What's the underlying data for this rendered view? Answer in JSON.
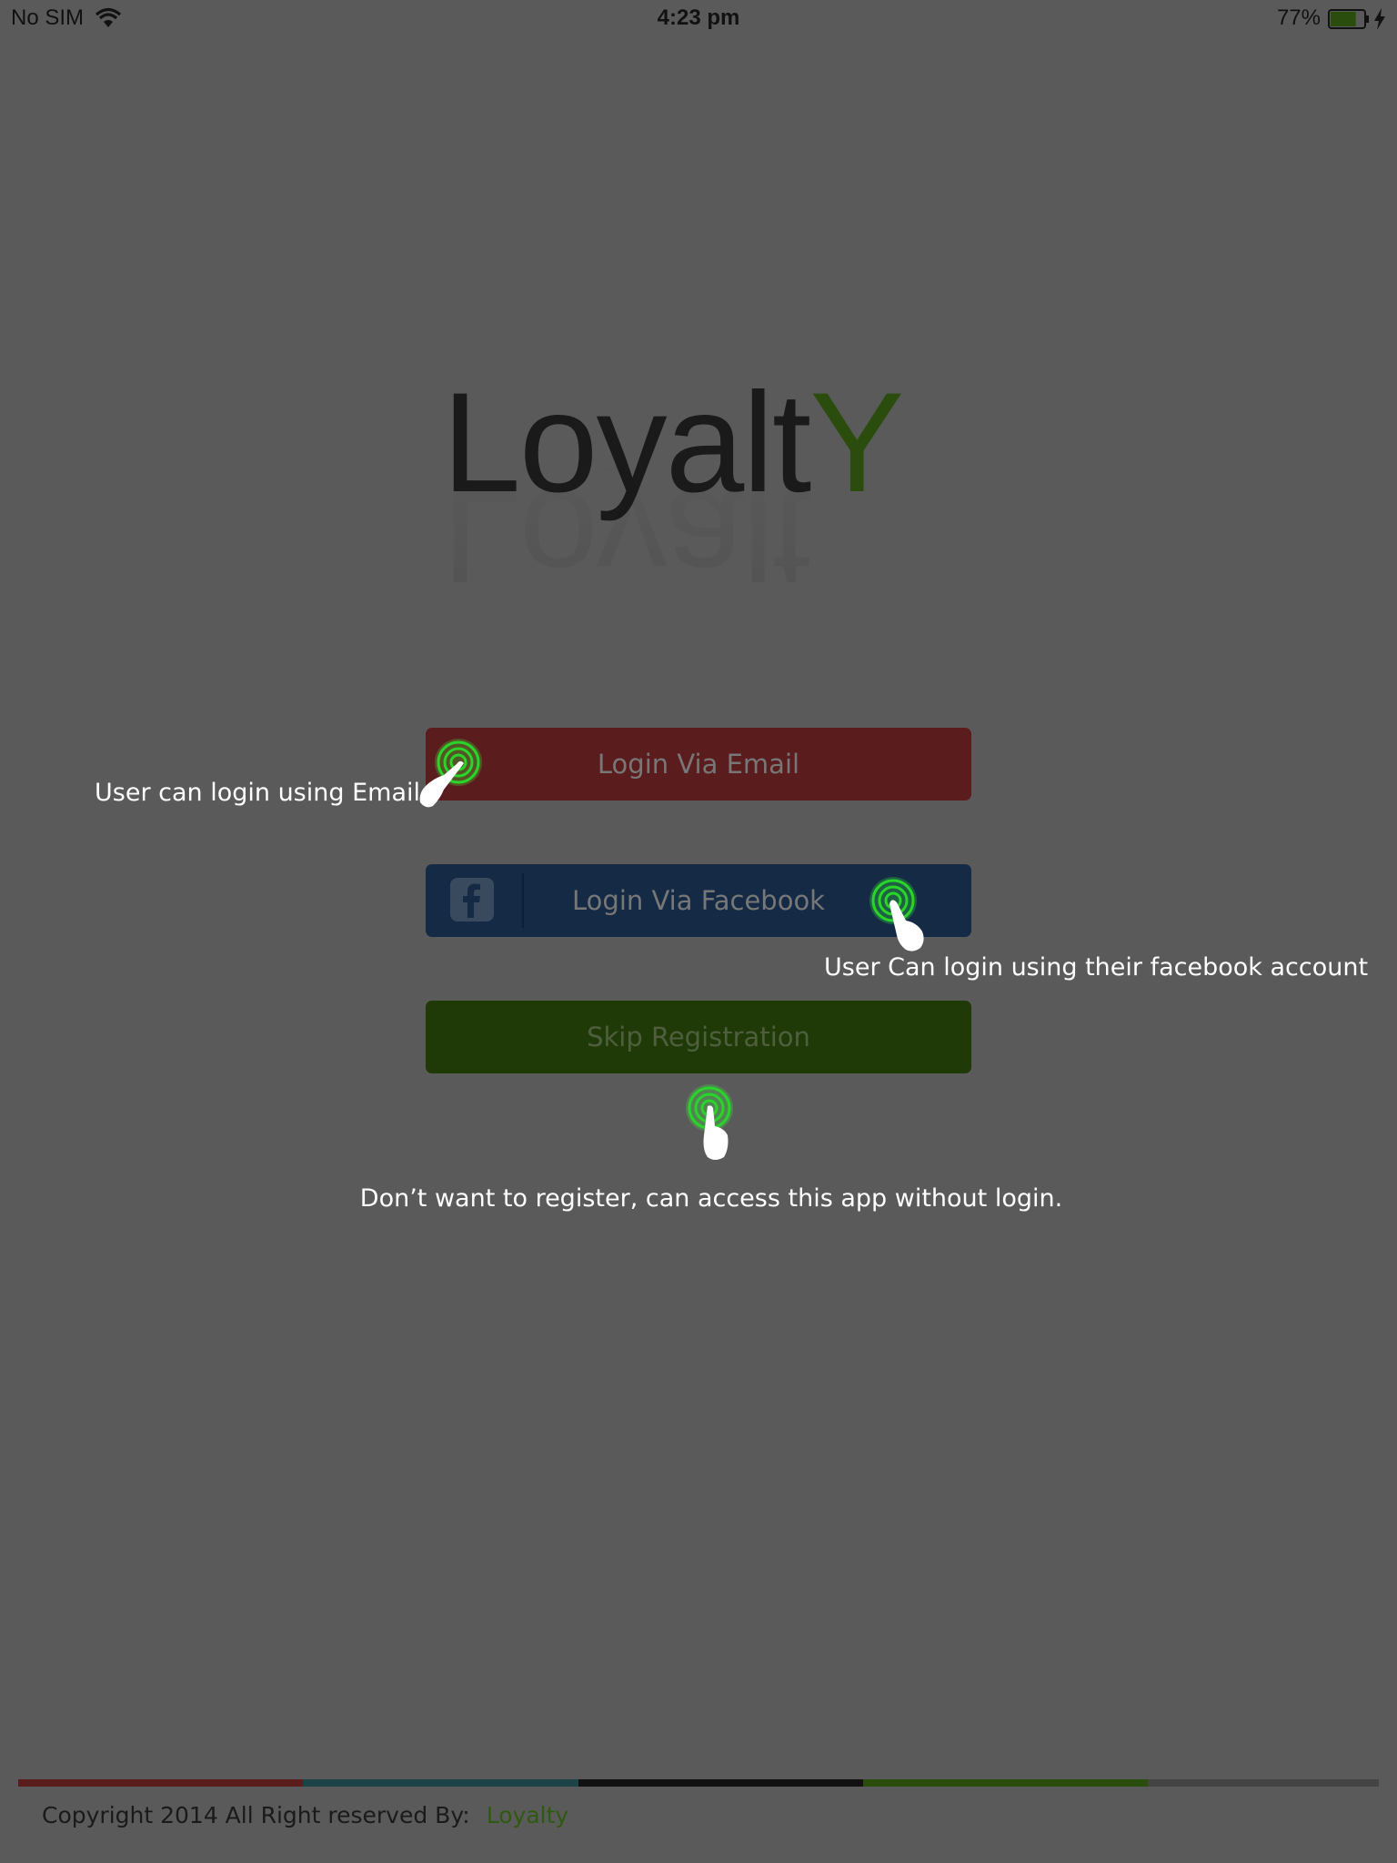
{
  "status_bar": {
    "carrier": "No SIM",
    "time": "4:23 pm",
    "battery_percent": "77%",
    "battery_level": 0.77,
    "wifi_icon": "wifi-icon",
    "charging_icon": "bolt-icon"
  },
  "logo": {
    "text_main": "Loyalt",
    "text_accent": "Y",
    "main_color": "#1a1a1a",
    "accent_color": "#2a4d0d"
  },
  "buttons": {
    "email_label": "Login Via Email",
    "facebook_label": "Login Via Facebook",
    "facebook_icon": "facebook-icon",
    "skip_label": "Skip Registration"
  },
  "annotations": {
    "email_note": "User can login using Email",
    "facebook_note": "User Can login using their facebook account",
    "skip_note": "Don’t want to register, can access this app without login.",
    "tap_icon": "tap-hand-icon"
  },
  "colors": {
    "email": "#5b1c1e",
    "facebook": "#152b45",
    "skip": "#1f3a07",
    "overlay_background": "#5a5a5a"
  },
  "footer": {
    "copyright": "Copyright 2014 All Right reserved By:",
    "brand": "Loyalty"
  }
}
